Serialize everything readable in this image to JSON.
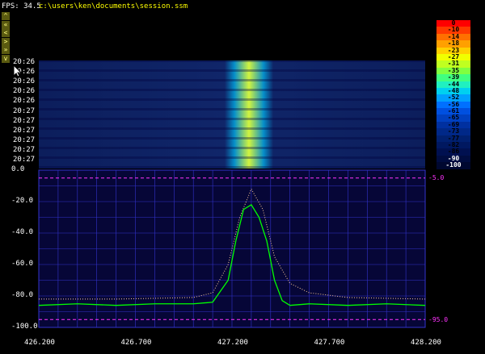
{
  "fps_text": "FPS: 34.5",
  "file_path": "c:\\users\\ken\\documents\\session.ssm",
  "nav_buttons": [
    {
      "label": "^",
      "icon": "up-arrow-icon"
    },
    {
      "label": "«",
      "icon": "double-left-icon"
    },
    {
      "label": "<",
      "icon": "left-arrow-icon"
    },
    {
      "label": ">",
      "icon": "right-arrow-icon"
    },
    {
      "label": "»",
      "icon": "double-right-icon"
    },
    {
      "label": "v",
      "icon": "down-arrow-icon"
    }
  ],
  "waterfall_times": [
    "20:26",
    "20:26",
    "20:26",
    "20:26",
    "20:26",
    "20:27",
    "20:27",
    "20:27",
    "20:27",
    "20:27",
    "20:27"
  ],
  "legend": [
    {
      "label": "0",
      "color": "#ff0000"
    },
    {
      "label": "-10",
      "color": "#ff3a00"
    },
    {
      "label": "-14",
      "color": "#ff7000"
    },
    {
      "label": "-18",
      "color": "#ffa000"
    },
    {
      "label": "-23",
      "color": "#ffd000"
    },
    {
      "label": "-27",
      "color": "#f0ff00"
    },
    {
      "label": "-31",
      "color": "#c0ff20"
    },
    {
      "label": "-35",
      "color": "#80ff40"
    },
    {
      "label": "-39",
      "color": "#40ff80"
    },
    {
      "label": "-44",
      "color": "#20f0c0"
    },
    {
      "label": "-48",
      "color": "#00d0f0"
    },
    {
      "label": "-52",
      "color": "#00a0ff"
    },
    {
      "label": "-56",
      "color": "#0070ff"
    },
    {
      "label": "-61",
      "color": "#0050e0"
    },
    {
      "label": "-65",
      "color": "#0040c0"
    },
    {
      "label": "-69",
      "color": "#0030a0"
    },
    {
      "label": "-73",
      "color": "#002888"
    },
    {
      "label": "-77",
      "color": "#002070"
    },
    {
      "label": "-82",
      "color": "#001860"
    },
    {
      "label": "-86",
      "color": "#001050"
    },
    {
      "label": "-90",
      "color": "#000c40"
    },
    {
      "label": "-100",
      "color": "#000830"
    }
  ],
  "colors": {
    "grid_bg": "#060637",
    "grid_line": "#3333cc",
    "trace": "#00ff00",
    "peak": "#ffcc99",
    "marker": "#ff33ff",
    "waterfall_bg": "#0c1e5c"
  },
  "chart_data": {
    "type": "line",
    "x_ticks": [
      "426.200",
      "426.700",
      "427.200",
      "427.700",
      "428.200"
    ],
    "y_ticks": [
      "0.0",
      "-20.0",
      "-40.0",
      "-60.0",
      "-80.0",
      "-100.0"
    ],
    "xlim": [
      426.2,
      428.2
    ],
    "ylim": [
      -100,
      0
    ],
    "marker_top": "-5.0",
    "marker_bottom": "-95.0",
    "series": [
      {
        "x": [
          426.2,
          426.4,
          426.6,
          426.8,
          427.0,
          427.1,
          427.18,
          427.22,
          427.26,
          427.3,
          427.34,
          427.38,
          427.42,
          427.46,
          427.5,
          427.6,
          427.8,
          428.0,
          428.2
        ],
        "y": [
          -86,
          -85,
          -86,
          -85,
          -85,
          -84,
          -70,
          -45,
          -25,
          -22,
          -30,
          -45,
          -70,
          -83,
          -86,
          -85,
          -86,
          -85,
          -86
        ]
      },
      {
        "x": [
          426.2,
          426.6,
          427.0,
          427.1,
          427.18,
          427.24,
          427.3,
          427.36,
          427.42,
          427.5,
          427.6,
          427.8,
          428.2
        ],
        "y": [
          -82,
          -82,
          -81,
          -78,
          -60,
          -30,
          -12,
          -25,
          -55,
          -72,
          -78,
          -81,
          -82
        ]
      }
    ]
  }
}
